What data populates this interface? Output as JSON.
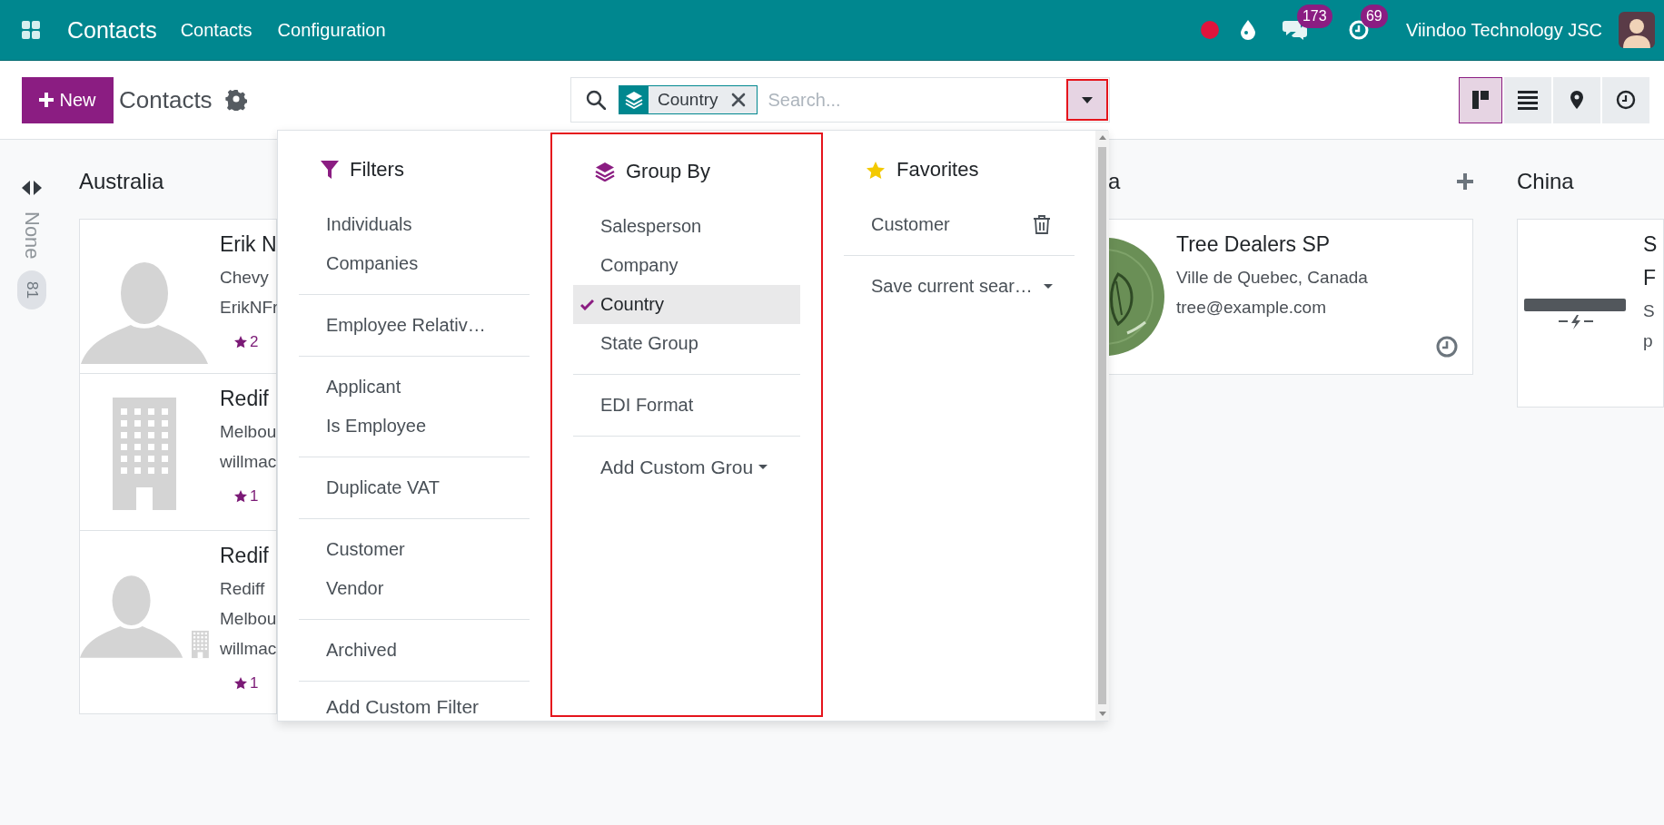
{
  "navbar": {
    "app_name": "Contacts",
    "menus": [
      "Contacts",
      "Configuration"
    ],
    "messages_badge": "173",
    "activities_badge": "69",
    "company": "Viindoo Technology JSC"
  },
  "control_panel": {
    "new_button": "New",
    "breadcrumb": "Contacts",
    "search": {
      "facet": "Country",
      "placeholder": "Search..."
    },
    "views": [
      {
        "kind": "kanban",
        "selected": true
      },
      {
        "kind": "list",
        "selected": false
      },
      {
        "kind": "map",
        "selected": false
      },
      {
        "kind": "activity",
        "selected": false
      }
    ]
  },
  "kanban": {
    "folded_column": {
      "title": "None",
      "count": "81"
    },
    "columns": [
      {
        "title": "Australia",
        "cards": [
          {
            "kind": "person",
            "name": "Erik N",
            "lines": [
              "Chevy",
              "ErikNFr"
            ],
            "rating": "2"
          },
          {
            "kind": "company",
            "name": "Redif",
            "lines": [
              "Melbou",
              "willmac"
            ],
            "rating": "1"
          },
          {
            "kind": "person-company",
            "name": "Redif",
            "lines": [
              "Rediff",
              "Melbou",
              "willmac"
            ],
            "rating": "1"
          }
        ]
      },
      {
        "title": "a",
        "add_button": true,
        "cards": [
          {
            "kind": "picture",
            "name": "Tree Dealers SP",
            "lines": [
              "Ville de Quebec, Canada",
              "tree@example.com"
            ],
            "activity": true
          }
        ]
      },
      {
        "title": "China",
        "cards": [
          {
            "kind": "logo",
            "name": "S",
            "lines": [
              "F",
              "S",
              "p"
            ]
          }
        ]
      }
    ]
  },
  "search_panel": {
    "filters": {
      "title": "Filters",
      "groups": [
        [
          {
            "label": "Individuals",
            "selected": false
          },
          {
            "label": "Companies",
            "selected": false
          }
        ],
        [
          {
            "label": "Employee Relativ…",
            "selected": false
          }
        ],
        [
          {
            "label": "Applicant",
            "selected": false
          },
          {
            "label": "Is Employee",
            "selected": false
          }
        ],
        [
          {
            "label": "Duplicate VAT",
            "selected": false
          }
        ],
        [
          {
            "label": "Customer",
            "selected": false
          },
          {
            "label": "Vendor",
            "selected": false
          }
        ],
        [
          {
            "label": "Archived",
            "selected": false
          }
        ]
      ],
      "custom": "Add Custom Filter"
    },
    "group_by": {
      "title": "Group By",
      "groups": [
        [
          {
            "label": "Salesperson",
            "selected": false
          },
          {
            "label": "Company",
            "selected": false
          },
          {
            "label": "Country",
            "selected": true
          },
          {
            "label": "State Group",
            "selected": false
          }
        ],
        [
          {
            "label": "EDI Format",
            "selected": false
          }
        ]
      ],
      "custom": "Add Custom Grou"
    },
    "favorites": {
      "title": "Favorites",
      "items": [
        "Customer"
      ],
      "save": "Save current sear…"
    }
  }
}
